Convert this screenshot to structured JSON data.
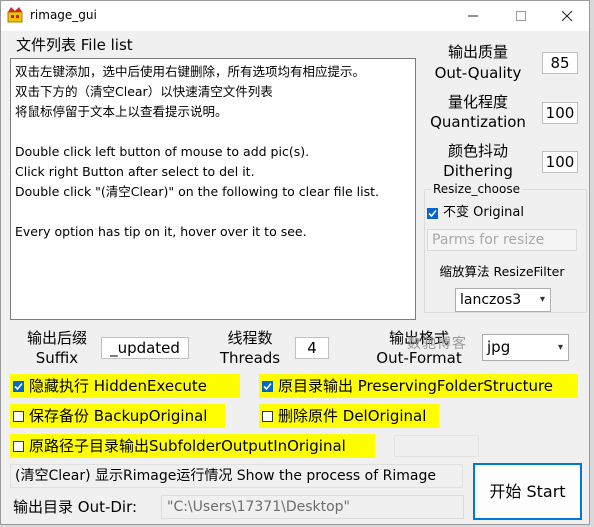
{
  "window": {
    "title": "rimage_gui"
  },
  "file_list": {
    "label": "文件列表 File list",
    "lines": [
      "双击左键添加，选中后使用右键删除，所有选项均有相应提示。",
      "双击下方的（清空Clear）以快速清空文件列表",
      "将鼠标停留于文本上以查看提示说明。",
      "",
      "Double click left button of mouse to add pic(s).",
      "Click right Button after select to del it.",
      "Double click \"(清空Clear)\" on the following to clear file list.",
      "",
      "Every option has tip on it, hover over it to see."
    ]
  },
  "settings": {
    "quality_label_cn": "输出质量",
    "quality_label_en": "Out-Quality",
    "quality_value": "85",
    "quantization_label_cn": "量化程度",
    "quantization_label_en": "Quantization",
    "quantization_value": "100",
    "dithering_label_cn": "颜色抖动",
    "dithering_label_en": "Dithering",
    "dithering_value": "100"
  },
  "resize": {
    "group_title": "Resize_choose",
    "original_label": "不变 Original",
    "original_checked": true,
    "parms_placeholder": "Parms for resize",
    "filter_label": "缩放算法 ResizeFilter",
    "filter_value": "lanczos3"
  },
  "output": {
    "suffix_label_cn": "输出后缀",
    "suffix_label_en": "Suffix",
    "suffix_value": "_updated",
    "threads_label_cn": "线程数",
    "threads_label_en": "Threads",
    "threads_value": "4",
    "format_label_cn": "输出格式",
    "format_label_en": "Out-Format",
    "format_value": "jpg"
  },
  "options": {
    "hidden_execute": "隐藏执行 HiddenExecute",
    "hidden_execute_checked": true,
    "preserve_structure": "原目录输出 PreservingFolderStructure",
    "preserve_structure_checked": true,
    "backup_original": "保存备份 BackupOriginal",
    "backup_original_checked": false,
    "del_original": "删除原件 DelOriginal",
    "del_original_checked": false,
    "subfolder_output": "原路径子目录输出SubfolderOutputInOriginal",
    "subfolder_output_checked": false
  },
  "bottom": {
    "log_text": "(清空Clear) 显示Rimage运行情况 Show the process of Rimage",
    "outdir_label": "输出目录 Out-Dir:",
    "outdir_value": "\"C:\\Users\\17371\\Desktop\"",
    "start_label": "开始 Start"
  },
  "watermark": {
    "line1": "数驰博客"
  },
  "colors": {
    "highlight": "#ffff00",
    "checkbox_on": "#0066cc",
    "start_border": "#0078d4"
  }
}
